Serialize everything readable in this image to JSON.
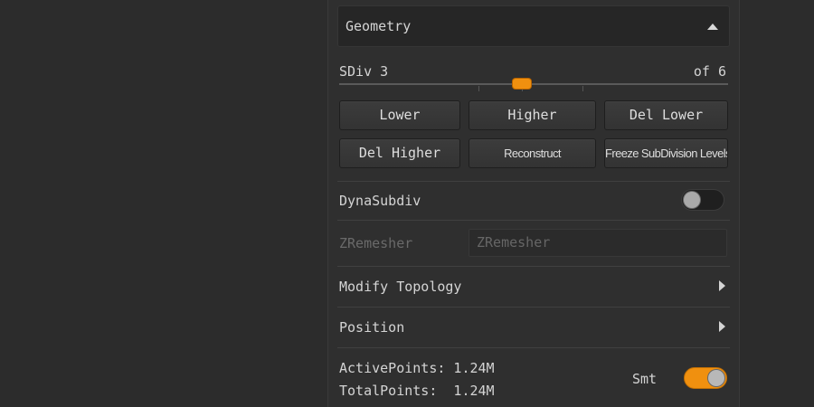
{
  "geometry": {
    "title": "Geometry",
    "collapse_icon": "triangle-up-icon"
  },
  "sdiv": {
    "label": "SDiv 3",
    "of_label": "of 6",
    "current": 3,
    "max": 6,
    "accent_color": "#f0900f"
  },
  "buttons": {
    "lower": "Lower",
    "higher": "Higher",
    "del_lower": "Del Lower",
    "del_higher": "Del Higher",
    "reconstruct": "Reconstruct",
    "freeze": "Freeze SubDivision Levels"
  },
  "dynasubdiv": {
    "label": "DynaSubdiv",
    "enabled": false
  },
  "zremesher": {
    "label": "ZRemesher",
    "button_label": "ZRemesher",
    "disabled": true
  },
  "modify_topology": {
    "label": "Modify Topology",
    "expand_icon": "triangle-right-icon"
  },
  "position": {
    "label": "Position",
    "expand_icon": "triangle-right-icon"
  },
  "stats": {
    "active_points": "ActivePoints: 1.24M",
    "total_points": "TotalPoints:  1.24M"
  },
  "smt": {
    "label": "Smt",
    "enabled": true
  }
}
